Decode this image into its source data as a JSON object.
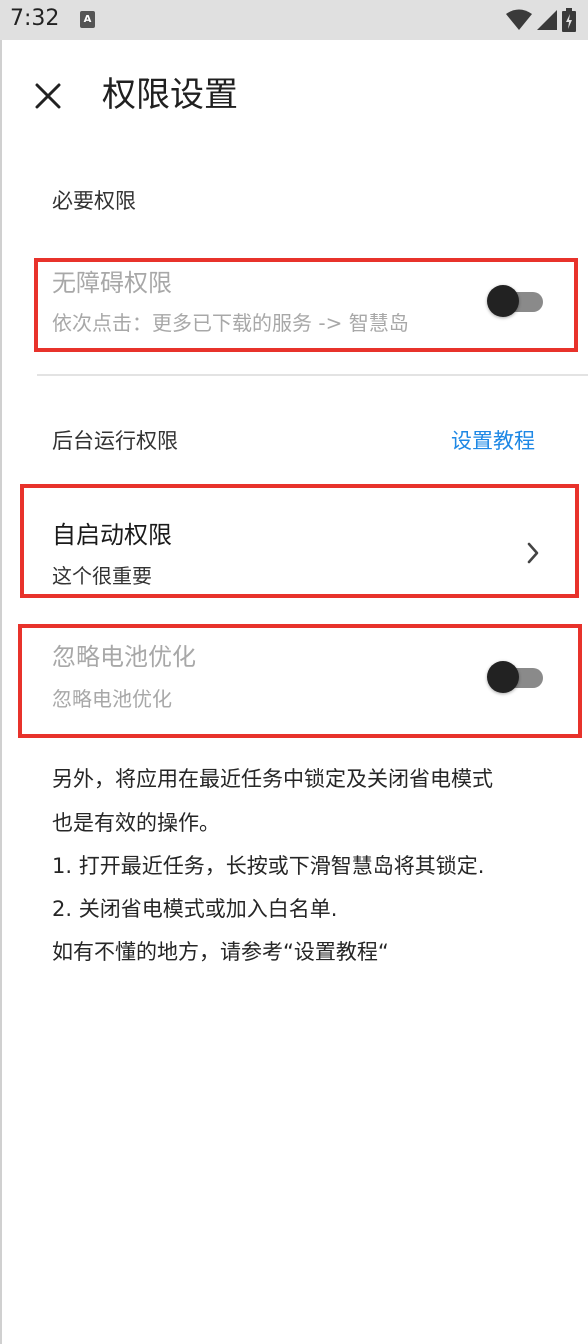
{
  "status_bar": {
    "time": "7:32",
    "icons": [
      "notification-a-icon",
      "wifi-icon",
      "cell-signal-icon",
      "battery-icon"
    ]
  },
  "header": {
    "title": "权限设置",
    "close_icon": "close-icon"
  },
  "sections": {
    "required": {
      "header": "必要权限",
      "accessibility": {
        "title": "无障碍权限",
        "subtitle": "依次点击：更多已下载的服务 -> 智慧岛",
        "enabled": false
      }
    },
    "background": {
      "header": "后台运行权限",
      "tutorial_link": "设置教程",
      "autostart": {
        "title": "自启动权限",
        "subtitle": "这个很重要"
      },
      "battery": {
        "title": "忽略电池优化",
        "subtitle": "忽略电池优化",
        "enabled": false
      }
    }
  },
  "notes": [
    "另外，将应用在最近任务中锁定及关闭省电模式",
    "也是有效的操作。",
    "1. 打开最近任务，长按或下滑智慧岛将其锁定.",
    "2. 关闭省电模式或加入白名单.",
    "如有不懂的地方，请参考“设置教程“"
  ],
  "colors": {
    "accent": "#1e88e5",
    "highlight_frame": "#e8322b",
    "disabled_text": "#a8a8a8",
    "status_bar": "#e0e0e0"
  }
}
